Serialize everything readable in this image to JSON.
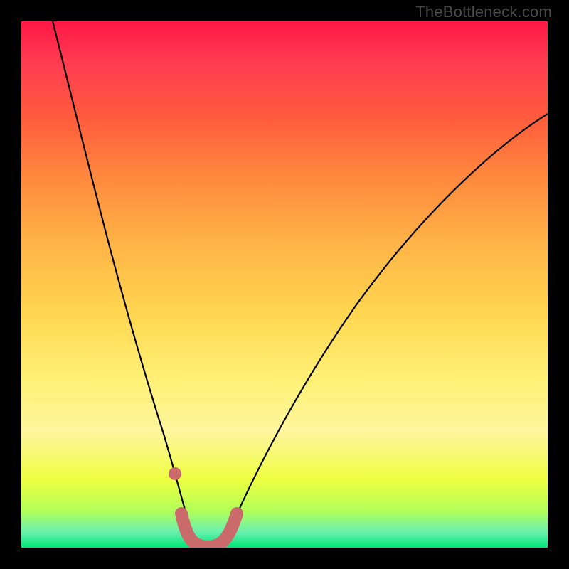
{
  "watermark": "TheBottleneck.com",
  "chart_data": {
    "type": "line",
    "title": "",
    "xlabel": "",
    "ylabel": "",
    "xlim": [
      0,
      100
    ],
    "ylim": [
      0,
      100
    ],
    "series": [
      {
        "name": "bottleneck-curve",
        "x": [
          6,
          8,
          10,
          12,
          14,
          16,
          18,
          20,
          22,
          24,
          26,
          28,
          30,
          31,
          32,
          33,
          34,
          35,
          36,
          38,
          40,
          42,
          45,
          50,
          55,
          60,
          65,
          70,
          75,
          80,
          85,
          90,
          95,
          100
        ],
        "y": [
          100,
          92,
          84,
          76,
          69,
          62,
          55,
          48,
          41,
          35,
          28,
          22,
          15,
          11,
          8,
          5,
          3,
          2,
          2,
          3,
          5,
          8,
          12,
          20,
          27,
          34,
          40,
          46,
          51,
          56,
          60,
          64,
          67,
          70
        ]
      },
      {
        "name": "marker-band",
        "x": [
          29,
          30,
          31,
          32,
          33,
          34,
          35,
          36,
          37,
          38,
          39
        ],
        "y": [
          14,
          7,
          3,
          2,
          2,
          2,
          2,
          2,
          3,
          4,
          6
        ]
      }
    ],
    "colors": {
      "curve": "#000000",
      "marker": "#cb6a6a",
      "gradient_top": "#ff1744",
      "gradient_bottom": "#00e676"
    }
  }
}
